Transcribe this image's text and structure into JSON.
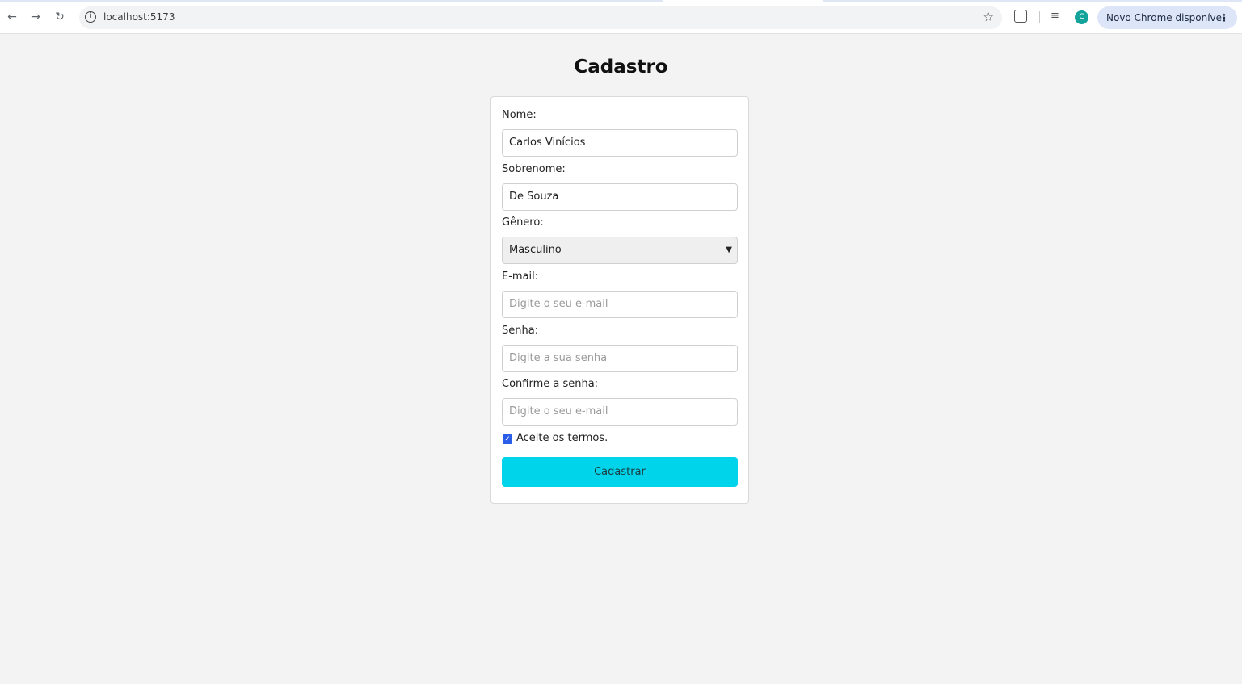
{
  "browser": {
    "url": "localhost:5173",
    "update_button_label": "Novo Chrome disponível",
    "profile_initial": "C",
    "icons": {
      "back": "arrow-left-icon",
      "forward": "arrow-right-icon",
      "reload": "reload-icon",
      "site_info": "info-icon",
      "bookmark": "star-icon",
      "extensions": "puzzle-icon",
      "media": "media-control-icon",
      "menu": "more-vert-icon"
    }
  },
  "page": {
    "title": "Cadastro"
  },
  "form": {
    "nome": {
      "label": "Nome:",
      "value": "Carlos Vinícios"
    },
    "sobrenome": {
      "label": "Sobrenome:",
      "value": "De Souza"
    },
    "genero": {
      "label": "Gênero:",
      "value": "Masculino"
    },
    "email": {
      "label": "E-mail:",
      "placeholder": "Digite o seu e-mail"
    },
    "senha": {
      "label": "Senha:",
      "placeholder": "Digite a sua senha"
    },
    "confirmar_senha": {
      "label": "Confirme a senha:",
      "placeholder": "Digite o seu e-mail"
    },
    "termos": {
      "label": "Aceite os termos.",
      "checked": true
    },
    "submit_label": "Cadastrar"
  },
  "colors": {
    "submit_button": "#00d4ea",
    "checkbox": "#2b5ee8",
    "page_background": "#f3f3f3"
  }
}
